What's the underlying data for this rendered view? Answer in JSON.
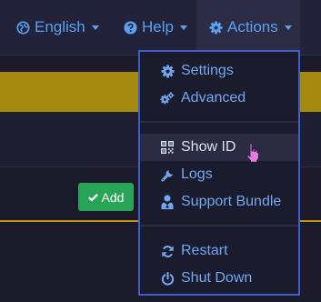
{
  "navbar": {
    "language": {
      "label": "English",
      "icon": "globe-icon"
    },
    "help": {
      "label": "Help",
      "icon": "question-circle-icon"
    },
    "actions": {
      "label": "Actions",
      "icon": "gear-icon"
    }
  },
  "page": {
    "add_label": "Add"
  },
  "actions_menu": {
    "items": [
      {
        "label": "Settings",
        "icon": "gear-icon"
      },
      {
        "label": "Advanced",
        "icon": "gears-icon"
      },
      {
        "label": "Show ID",
        "icon": "qrcode-icon"
      },
      {
        "label": "Logs",
        "icon": "wrench-icon"
      },
      {
        "label": "Support Bundle",
        "icon": "user-doctor-icon"
      },
      {
        "label": "Restart",
        "icon": "refresh-icon"
      },
      {
        "label": "Shut Down",
        "icon": "power-off-icon"
      }
    ]
  },
  "colors": {
    "accent": "#5aa1f0",
    "menu_border": "#3f5ec9",
    "warning_band": "#a58a0f",
    "add_button": "#27a456"
  }
}
